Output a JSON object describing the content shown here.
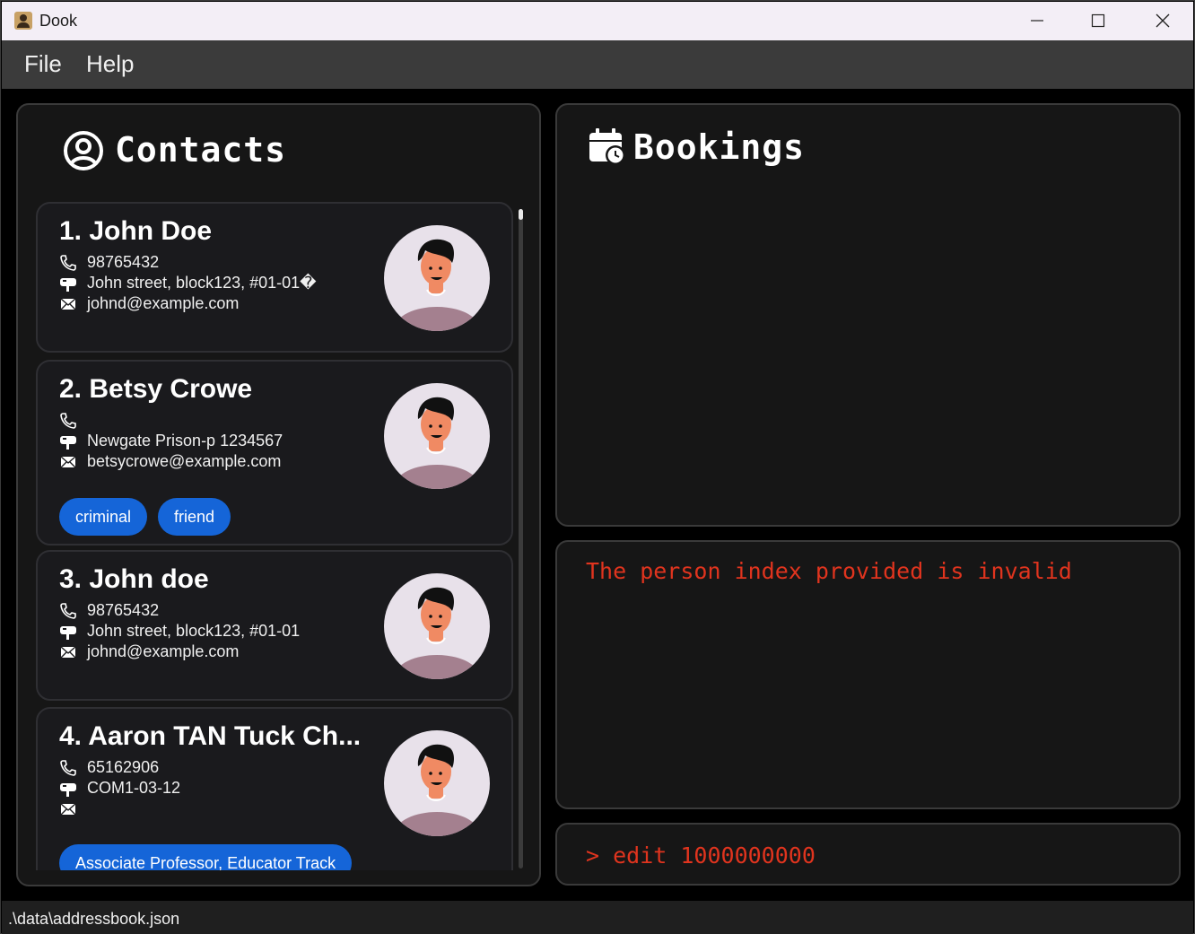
{
  "window": {
    "title": "Dook"
  },
  "menu": {
    "file": "File",
    "help": "Help"
  },
  "contacts_panel": {
    "title": "Contacts",
    "cards": [
      {
        "name": "1. John Doe",
        "phone": "98765432",
        "address": "John street, block123, #01-01�",
        "email": "johnd@example.com",
        "tags": []
      },
      {
        "name": "2. Betsy Crowe",
        "phone": "",
        "address": "Newgate Prison-p 1234567",
        "email": "betsycrowe@example.com",
        "tags": [
          "criminal",
          "friend"
        ]
      },
      {
        "name": "3. John doe",
        "phone": "98765432",
        "address": "John street, block123, #01-01",
        "email": "johnd@example.com",
        "tags": []
      },
      {
        "name": "4. Aaron TAN Tuck Ch...",
        "phone": "65162906",
        "address": "COM1-03-12",
        "email": "",
        "tags": [
          "Associate Professor, Educator Track"
        ]
      }
    ]
  },
  "bookings_panel": {
    "title": "Bookings"
  },
  "result_display": {
    "text": "The person index provided is invalid"
  },
  "command_box": {
    "text": "> edit 1000000000"
  },
  "status_bar": {
    "path": ".\\data\\addressbook.json"
  },
  "icons": [
    "user-circle-icon",
    "calendar-clock-icon",
    "phone-icon",
    "mailbox-icon",
    "envelope-icon"
  ],
  "colors": {
    "tag": "#1565d8",
    "result_text": "#e0341e",
    "panel_bg": "#161616"
  }
}
